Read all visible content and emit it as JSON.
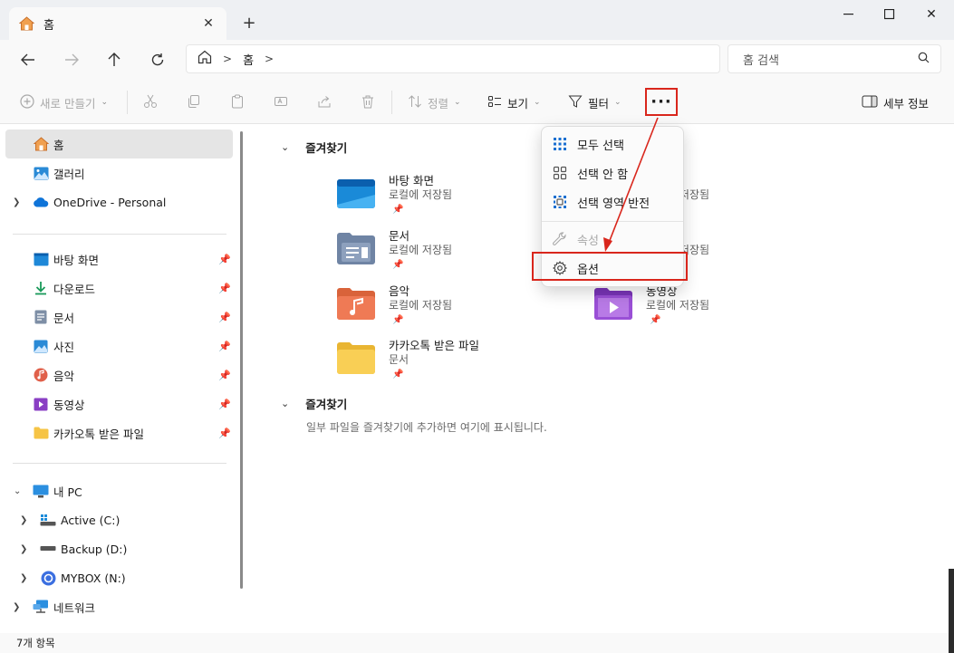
{
  "tab": {
    "title": "홈",
    "home_icon": "home-icon",
    "close_icon": "close-icon"
  },
  "window": {
    "minimize": "minimize-icon",
    "maximize": "maximize-icon",
    "close": "close-icon"
  },
  "nav": {
    "back": "arrow-left-icon",
    "forward": "arrow-right-icon",
    "up": "arrow-up-icon",
    "refresh": "refresh-icon",
    "breadcrumb": [
      "홈"
    ],
    "search_placeholder": "홈 검색"
  },
  "toolbar": {
    "new_label": "새로 만들기",
    "sort_label": "정렬",
    "view_label": "보기",
    "filter_label": "필터",
    "more_label": "···",
    "details_label": "세부 정보"
  },
  "sidebar": {
    "top": [
      {
        "label": "홈",
        "icon": "home-icon",
        "selected": true
      },
      {
        "label": "갤러리",
        "icon": "gallery-icon"
      },
      {
        "label": "OneDrive - Personal",
        "icon": "cloud-icon"
      }
    ],
    "pinned": [
      {
        "label": "바탕 화면",
        "icon": "desktop-icon"
      },
      {
        "label": "다운로드",
        "icon": "download-icon"
      },
      {
        "label": "문서",
        "icon": "document-icon"
      },
      {
        "label": "사진",
        "icon": "picture-icon"
      },
      {
        "label": "음악",
        "icon": "music-icon"
      },
      {
        "label": "동영상",
        "icon": "video-icon"
      },
      {
        "label": "카카오톡 받은 파일",
        "icon": "folder-icon"
      }
    ],
    "pc": {
      "label": "내 PC",
      "drives": [
        {
          "label": "Active (C:)",
          "icon": "drive-icon"
        },
        {
          "label": "Backup (D:)",
          "icon": "drive-icon"
        },
        {
          "label": "MYBOX (N:)",
          "icon": "mybox-icon"
        }
      ]
    },
    "network": {
      "label": "네트워크",
      "icon": "network-icon"
    }
  },
  "content": {
    "section1": "즐겨찾기",
    "tiles": [
      {
        "name": "바탕 화면",
        "sub": "로컬에 저장됨"
      },
      {
        "name": "문서",
        "sub": "로컬에 저장됨"
      },
      {
        "name": "음악",
        "sub": "로컬에 저장됨"
      },
      {
        "name": "카카오톡 받은 파일",
        "sub": "문서"
      }
    ],
    "tiles_right": [
      {
        "name": "",
        "sub": "로컬에 저장됨"
      },
      {
        "name": "",
        "sub": "로컬에 저장됨"
      },
      {
        "name": "동영상",
        "sub": "로컬에 저장됨"
      }
    ],
    "section2": "즐겨찾기",
    "empty_message": "일부 파일을 즐겨찾기에 추가하면 여기에 표시됩니다."
  },
  "menu": {
    "items": [
      {
        "label": "모두 선택",
        "icon": "select-all-icon"
      },
      {
        "label": "선택 안 함",
        "icon": "select-none-icon"
      },
      {
        "label": "선택 영역 반전",
        "icon": "invert-selection-icon"
      },
      {
        "label": "속성",
        "icon": "wrench-icon",
        "disabled": true
      },
      {
        "label": "옵션",
        "icon": "gear-icon"
      }
    ]
  },
  "status": {
    "count": "7개 항목"
  },
  "colors": {
    "highlight": "#d9261c",
    "accent": "#0067c0"
  }
}
